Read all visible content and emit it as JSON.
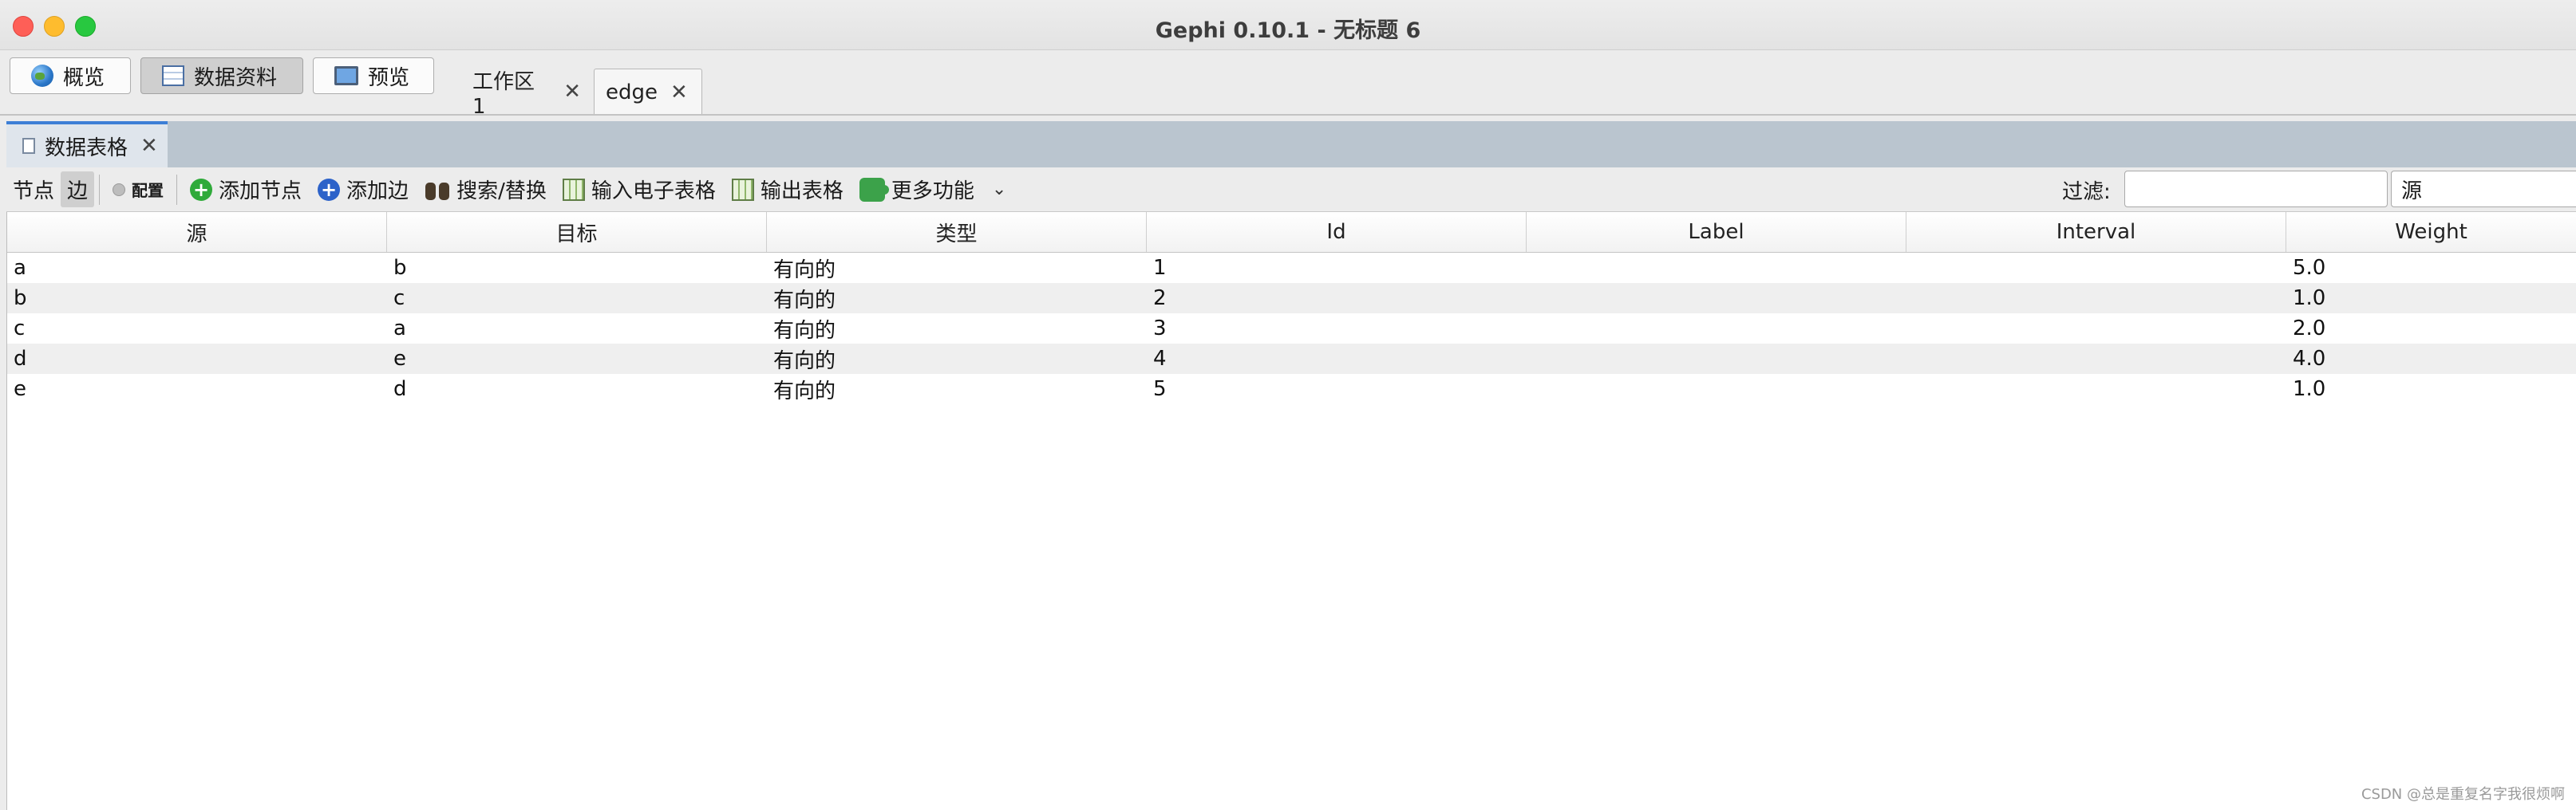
{
  "window": {
    "title": "Gephi 0.10.1 - 无标题 6"
  },
  "modes": [
    {
      "label": "概览",
      "icon": "globe-icon",
      "active": false
    },
    {
      "label": "数据资料",
      "icon": "table-icon",
      "active": true
    },
    {
      "label": "预览",
      "icon": "monitor-icon",
      "active": false
    }
  ],
  "doc_tabs": [
    {
      "label": "工作区 1",
      "active": false
    },
    {
      "label": "edge",
      "active": true
    }
  ],
  "panel": {
    "tab_label": "数据表格"
  },
  "toolbar": {
    "nodes_label": "节点",
    "edges_label": "边",
    "config_label": "配置",
    "add_node_label": "添加节点",
    "add_edge_label": "添加边",
    "search_replace_label": "搜索/替换",
    "import_sheet_label": "输入电子表格",
    "export_table_label": "输出表格",
    "more_label": "更多功能",
    "filter_label": "过滤:",
    "filter_value": "",
    "filter_column": "源"
  },
  "table": {
    "columns": [
      "源",
      "目标",
      "类型",
      "Id",
      "Label",
      "Interval",
      "Weight"
    ],
    "rows": [
      [
        "a",
        "b",
        "有向的",
        "1",
        "",
        "",
        "5.0"
      ],
      [
        "b",
        "c",
        "有向的",
        "2",
        "",
        "",
        "1.0"
      ],
      [
        "c",
        "a",
        "有向的",
        "3",
        "",
        "",
        "2.0"
      ],
      [
        "d",
        "e",
        "有向的",
        "4",
        "",
        "",
        "4.0"
      ],
      [
        "e",
        "d",
        "有向的",
        "5",
        "",
        "",
        "1.0"
      ]
    ]
  },
  "watermark": "CSDN @总是重复名字我很烦啊"
}
